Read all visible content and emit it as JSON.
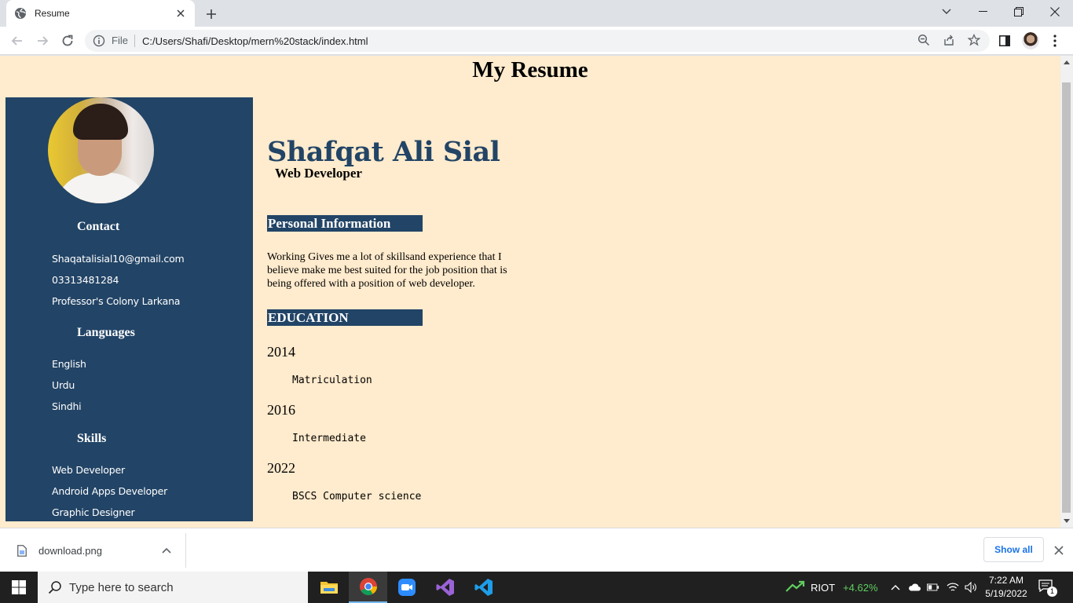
{
  "browser": {
    "tab_title": "Resume",
    "address_scheme_label": "File",
    "url": "C:/Users/Shafi/Desktop/mern%20stack/index.html"
  },
  "page": {
    "heading": "My Resume",
    "sidebar": {
      "contact_heading": "Contact",
      "contact": [
        "Shaqatalisial10@gmail.com",
        "03313481284",
        "Professor's Colony Larkana"
      ],
      "languages_heading": "Languages",
      "languages": [
        "English",
        "Urdu",
        "Sindhi"
      ],
      "skills_heading": "Skills",
      "skills": [
        "Web Developer",
        "Android Apps Developer",
        "Graphic Designer"
      ]
    },
    "main": {
      "name": "Shafqat Ali Sial",
      "role": "Web Developer",
      "personal_heading": "Personal Information",
      "personal_text": "Working Gives me a lot of skillsand experience that I believe make me best suited for the job position that is being offered with a position of web developer.",
      "education_heading": "EDUCATION",
      "education": [
        {
          "year": "2014",
          "degree": "Matriculation"
        },
        {
          "year": "2016",
          "degree": "Intermediate"
        },
        {
          "year": "2022",
          "degree": "BSCS Computer science"
        }
      ]
    }
  },
  "downloads": {
    "file_name": "download.png",
    "show_all_label": "Show all"
  },
  "taskbar": {
    "search_placeholder": "Type here to search",
    "stock_name": "RIOT",
    "stock_change": "+4.62%",
    "time": "7:22 AM",
    "date": "5/19/2022",
    "notification_count": "1"
  },
  "colors": {
    "page_background": "#ffebcd",
    "accent_navy": "#224466",
    "chrome_frame": "#dee1e6",
    "stock_up_green": "#5fce5f"
  }
}
